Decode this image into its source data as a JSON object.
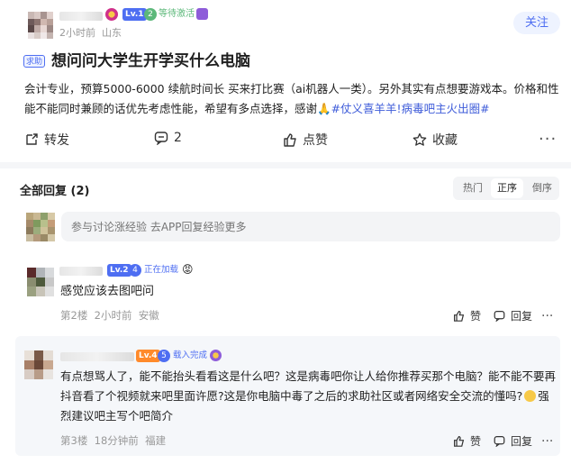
{
  "post": {
    "author_meta": "2小时前  山东",
    "badge_text": "等待激活",
    "level": "Lv.1",
    "badge_num": "2",
    "follow_label": "关注",
    "tag": "求助",
    "title": "想问问大学生开学买什么电脑",
    "body_text": "会计专业，预算5000-6000 续航时间长 买来打比赛（ai机器人一类）。另外其实有点想要游戏本。价格和性能不能同时兼顾的话优先考虑性能，希望有多点选择，感谢🙏",
    "hashtags": "#仗义喜羊羊!病毒吧主火出圈#",
    "actions": {
      "share": "转发",
      "comment_count": "2",
      "like": "点赞",
      "favorite": "收藏"
    }
  },
  "replies_header": {
    "title": "全部回复 (2)",
    "sort_options": [
      "热门",
      "正序",
      "倒序"
    ],
    "selected_sort": "正序"
  },
  "reply_input": {
    "placeholder": "参与讨论涨经验 去APP回复经验更多"
  },
  "comments": [
    {
      "level": "Lv.2",
      "badge_num": "4",
      "status": "正在加载",
      "text": "感觉应该去图吧问",
      "meta": "第2楼  2小时前  安徽",
      "like_label": "赞",
      "reply_label": "回复"
    },
    {
      "level": "Lv.4",
      "badge_num": "5",
      "status": "载入完成",
      "text": "有点想骂人了，能不能抬头看看这是什么吧？这是病毒吧你让人给你推荐买那个电脑？能不能不要再抖音看了个视频就来吧里面许愿?这是你电脑中毒了之后的求助社区或者网络安全交流的懂吗?",
      "text_tail": "强烈建议吧主写个吧简介",
      "meta": "第3楼  18分钟前  福建",
      "like_label": "赞",
      "reply_label": "回复"
    }
  ],
  "icons": [
    "badge-flower-icon",
    "badge-purple-icon",
    "share-icon",
    "comment-icon",
    "like-icon",
    "favorite-icon",
    "more-icon",
    "heart-icon",
    "fire-icon",
    "emoji-icon"
  ],
  "colors": {
    "accent": "#4e6ef2",
    "tag_bg": "#eef2ff",
    "follow_bg": "#eef3ff",
    "comment_bg": "#f5f7fa"
  }
}
